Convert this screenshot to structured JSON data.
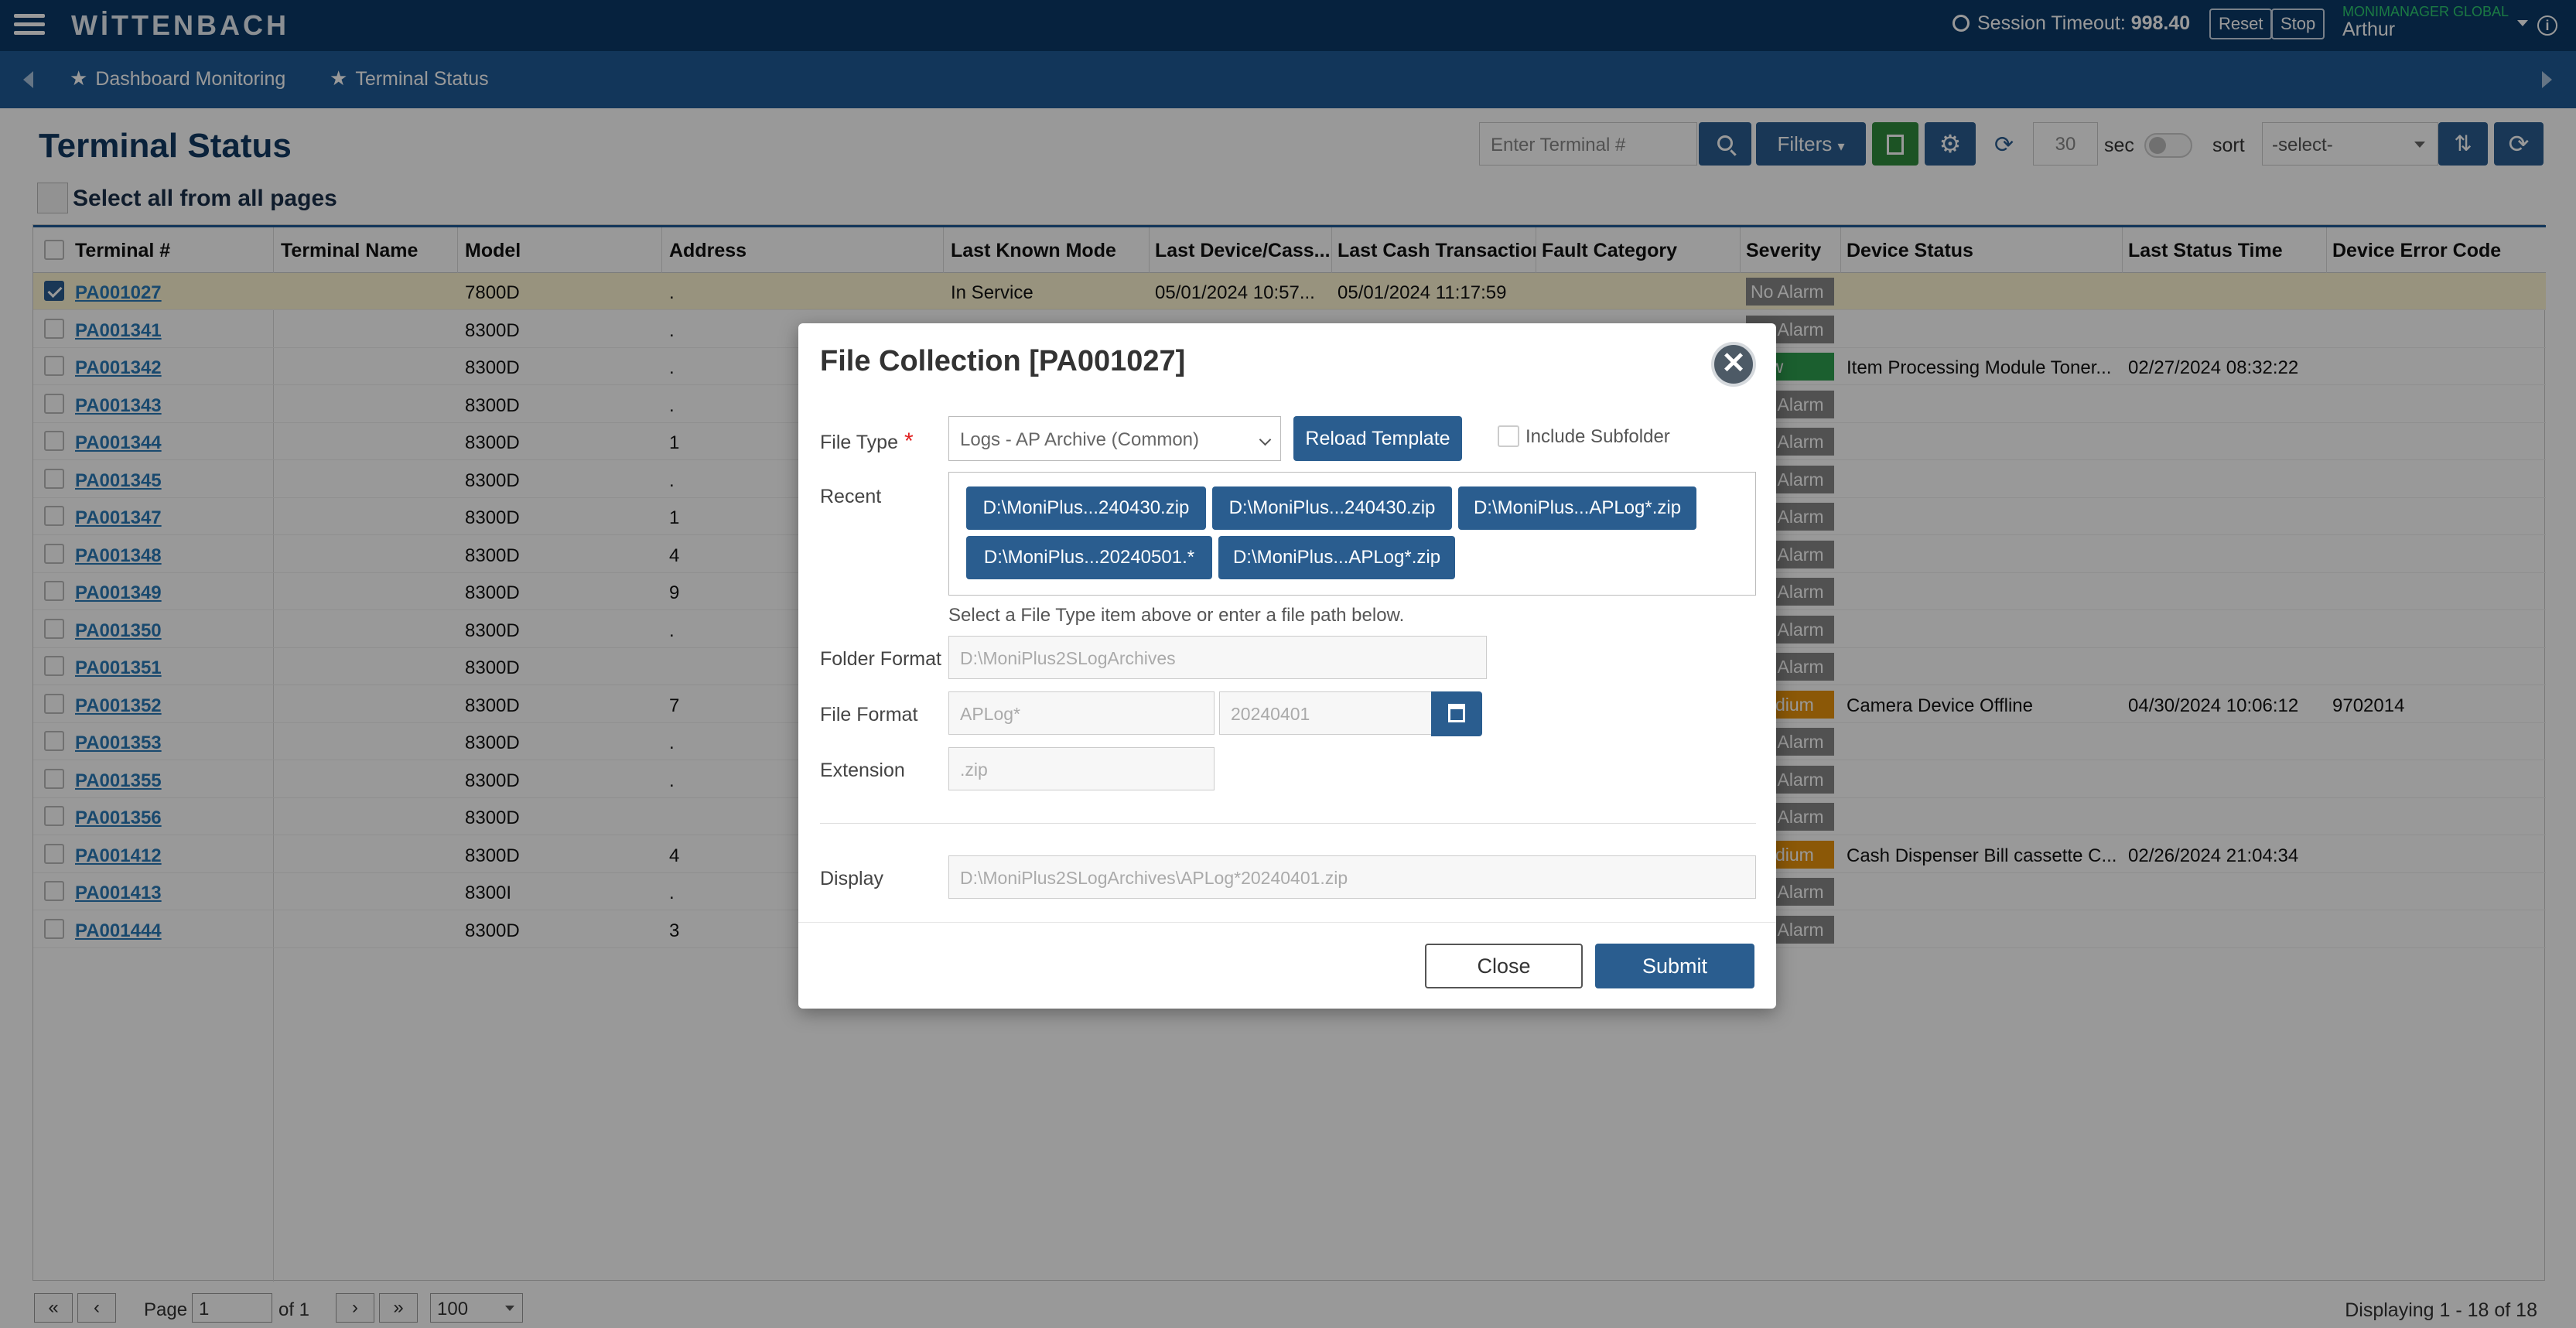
{
  "app": {
    "logo": "WİTTENBACH"
  },
  "topbar": {
    "session_label": "Session Timeout: ",
    "session_value": "998.40",
    "reset_label": "Reset",
    "stop_label": "Stop",
    "org": "MONIMANAGER GLOBAL",
    "user": "Arthur",
    "info": "i"
  },
  "nav": {
    "items": [
      "Dashboard Monitoring",
      "Terminal Status"
    ]
  },
  "page": {
    "title": "Terminal Status",
    "select_all": "Select all from all pages"
  },
  "toolbar": {
    "terminal_placeholder": "Enter Terminal #",
    "filters_label": "Filters",
    "refresh_seconds": "30",
    "sec_label": "sec",
    "sort_label": "sort",
    "sort_value": "-select-"
  },
  "grid": {
    "columns": [
      "Terminal #",
      "Terminal Name",
      "Model",
      "Address",
      "Last Known Mode",
      "Last Device/Cass...",
      "Last Cash Transaction",
      "Fault Category",
      "Severity",
      "Device Status",
      "Last Status Time",
      "Device Error Code"
    ],
    "rows": [
      {
        "terminal": "PA001027",
        "model": "7800D",
        "addr": ".",
        "mode": "In Service",
        "last_device": "05/01/2024 10:57...",
        "last_cash": "05/01/2024 11:17:59",
        "severity": "No Alarm",
        "sev_type": "none",
        "status": "",
        "status_time": "",
        "error_code": "",
        "checked": true
      },
      {
        "terminal": "PA001341",
        "model": "8300D",
        "addr": ".",
        "severity": "No Alarm",
        "sev_type": "none"
      },
      {
        "terminal": "PA001342",
        "model": "8300D",
        "addr": ".",
        "severity": "Low",
        "sev_type": "low",
        "status": "Item Processing Module Toner...",
        "status_time": "02/27/2024 08:32:22"
      },
      {
        "terminal": "PA001343",
        "model": "8300D",
        "addr": ".",
        "severity": "No Alarm",
        "sev_type": "none"
      },
      {
        "terminal": "PA001344",
        "model": "8300D",
        "addr": "1",
        "severity": "No Alarm",
        "sev_type": "none"
      },
      {
        "terminal": "PA001345",
        "model": "8300D",
        "addr": ".",
        "severity": "No Alarm",
        "sev_type": "none"
      },
      {
        "terminal": "PA001347",
        "model": "8300D",
        "addr": "1",
        "severity": "No Alarm",
        "sev_type": "none"
      },
      {
        "terminal": "PA001348",
        "model": "8300D",
        "addr": "4",
        "severity": "No Alarm",
        "sev_type": "none"
      },
      {
        "terminal": "PA001349",
        "model": "8300D",
        "addr": "9",
        "severity": "No Alarm",
        "sev_type": "none"
      },
      {
        "terminal": "PA001350",
        "model": "8300D",
        "addr": ".",
        "severity": "No Alarm",
        "sev_type": "none"
      },
      {
        "terminal": "PA001351",
        "model": "8300D",
        "addr": "",
        "severity": "No Alarm",
        "sev_type": "none"
      },
      {
        "terminal": "PA001352",
        "model": "8300D",
        "addr": "7",
        "severity": "Medium",
        "sev_type": "med",
        "status": "Camera Device Offline",
        "status_time": "04/30/2024 10:06:12",
        "error_code": "9702014"
      },
      {
        "terminal": "PA001353",
        "model": "8300D",
        "addr": ".",
        "severity": "No Alarm",
        "sev_type": "none"
      },
      {
        "terminal": "PA001355",
        "model": "8300D",
        "addr": ".",
        "severity": "No Alarm",
        "sev_type": "none"
      },
      {
        "terminal": "PA001356",
        "model": "8300D",
        "addr": "",
        "severity": "No Alarm",
        "sev_type": "none"
      },
      {
        "terminal": "PA001412",
        "model": "8300D",
        "addr": "4",
        "severity": "Medium",
        "sev_type": "med",
        "status": "Cash Dispenser Bill cassette C...",
        "status_time": "02/26/2024 21:04:34"
      },
      {
        "terminal": "PA001413",
        "model": "8300I",
        "addr": ".",
        "severity": "No Alarm",
        "sev_type": "none"
      },
      {
        "terminal": "PA001444",
        "model": "8300D",
        "addr": "3",
        "severity": "No Alarm",
        "sev_type": "none"
      }
    ]
  },
  "pager": {
    "first": "«",
    "prev": "‹",
    "next": "›",
    "last": "»",
    "page_label": "Page",
    "page_value": "1",
    "of_label": "of 1",
    "page_size": "100",
    "display": "Displaying 1 - 18 of 18"
  },
  "modal": {
    "title": "File Collection [PA001027]",
    "close_x": "✕",
    "file_type_label": "File Type",
    "required_mark": "*",
    "file_type_value": "Logs - AP Archive (Common)",
    "reload_label": "Reload Template",
    "include_subfolder": "Include Subfolder",
    "recent_label": "Recent",
    "recent_items": [
      "D:\\MoniPlus...240430.zip",
      "D:\\MoniPlus...240430.zip",
      "D:\\MoniPlus...APLog*.zip",
      "D:\\MoniPlus...20240501.*",
      "D:\\MoniPlus...APLog*.zip"
    ],
    "hint": "Select a File Type item above or enter a file path below.",
    "folder_format_label": "Folder Format",
    "folder_format_placeholder": "D:\\MoniPlus2SLogArchives",
    "file_format_label": "File Format",
    "file_format_placeholder": "APLog*",
    "date_placeholder": "20240401",
    "extension_label": "Extension",
    "extension_placeholder": ".zip",
    "display_label": "Display",
    "display_placeholder": "D:\\MoniPlus2SLogArchives\\APLog*20240401.zip",
    "close_label": "Close",
    "submit_label": "Submit"
  }
}
